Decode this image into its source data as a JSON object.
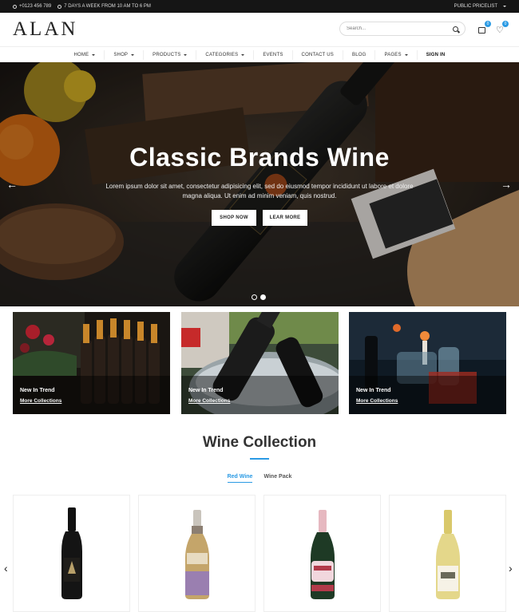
{
  "topbar": {
    "phone": "+0123 456 789",
    "hours": "7 DAYS A WEEK FROM 10 AM TO 6 PM",
    "pricelist": "PUBLIC PRICELIST"
  },
  "header": {
    "logo": "ALAN",
    "search_placeholder": "Search...",
    "cart_count": "0",
    "wishlist_count": "0"
  },
  "nav": {
    "items": [
      {
        "label": "HOME",
        "dropdown": true
      },
      {
        "label": "SHOP",
        "dropdown": true
      },
      {
        "label": "PRODUCTS",
        "dropdown": true
      },
      {
        "label": "CATEGORIES",
        "dropdown": true
      },
      {
        "label": "EVENTS",
        "dropdown": false
      },
      {
        "label": "CONTACT US",
        "dropdown": false
      },
      {
        "label": "BLOG",
        "dropdown": false
      },
      {
        "label": "PAGES",
        "dropdown": true
      },
      {
        "label": "SIGN IN",
        "dropdown": false
      }
    ]
  },
  "hero": {
    "title": "Classic Brands Wine",
    "text": "Lorem ipsum dolor sit amet, consectetur adipisicing elit, sed do eiusmod tempor incididunt ut labore et dolore magna aliqua. Ut enim ad minim veniam, quis nostrud.",
    "btn_shop": "SHOP NOW",
    "btn_learn": "LEAR MORE",
    "prev_icon": "arrow-left-icon",
    "next_icon": "arrow-right-icon",
    "slide_count": 2,
    "active_slide": 2
  },
  "banners": [
    {
      "subtitle": "New In Trend",
      "link": "More Collections"
    },
    {
      "subtitle": "New In Trend",
      "link": "More Collections"
    },
    {
      "subtitle": "New In Trend",
      "link": "More Collections"
    }
  ],
  "collection": {
    "title": "Wine Collection",
    "tabs": [
      "Red Wine",
      "Wine Pack"
    ],
    "active_tab": "Red Wine"
  },
  "colors": {
    "accent": "#2a9ae4",
    "topbar": "#151515"
  }
}
